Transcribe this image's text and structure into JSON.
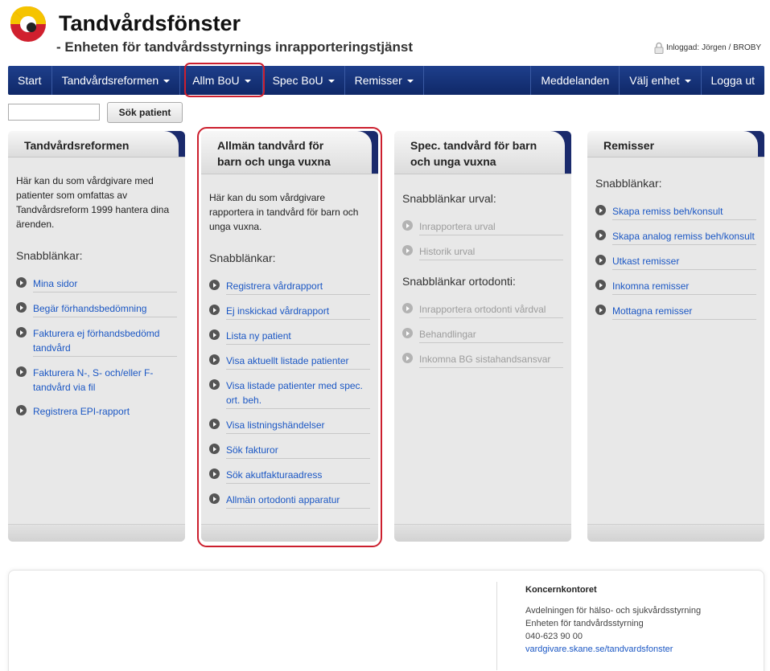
{
  "header": {
    "title": "Tandvårdsfönster",
    "subtitle": "- Enheten för tandvårdsstyrnings inrapporteringstjänst",
    "login_label": "Inloggad:",
    "login_user": "Jörgen / BROBY"
  },
  "nav": {
    "items": [
      {
        "label": "Start"
      },
      {
        "label": "Tandvårdsreformen"
      },
      {
        "label": "Allm BoU"
      },
      {
        "label": "Spec BoU"
      },
      {
        "label": "Remisser"
      }
    ],
    "right_items": [
      {
        "label": "Meddelanden"
      },
      {
        "label": "Välj enhet"
      },
      {
        "label": "Logga ut"
      }
    ]
  },
  "search": {
    "value": "",
    "button_label": "Sök patient"
  },
  "panels": [
    {
      "title": "Tandvårdsreformen",
      "intro": "Här kan du som vårdgivare med patienter som omfattas av Tandvårdsreform 1999 hantera dina ärenden.",
      "subhead": "Snabblänkar:",
      "links": [
        "Mina sidor",
        "Begär förhandsbedömning",
        "Fakturera ej förhandsbedömd tandvård",
        "Fakturera N-, S- och/eller F-tandvård via fil",
        "Registrera EPI-rapport"
      ]
    },
    {
      "title": "Allmän tandvård för barn och unga vuxna",
      "intro": "Här kan du som vårdgivare rapportera in tandvård för barn och unga vuxna.",
      "subhead": "Snabblänkar:",
      "links": [
        "Registrera vårdrapport",
        "Ej inskickad vårdrapport",
        "Lista ny patient",
        "Visa aktuellt listade patienter",
        "Visa listade patienter med spec. ort. beh.",
        "Visa listningshändelser",
        "Sök fakturor",
        "Sök akutfakturaadress",
        "Allmän ortodonti apparatur"
      ]
    },
    {
      "title": "Spec. tandvård för barn och unga vuxna",
      "subhead_urval": "Snabblänkar urval:",
      "links_urval": [
        "Inrapportera urval",
        "Historik urval"
      ],
      "subhead_ortodonti": "Snabblänkar ortodonti:",
      "links_ortodonti": [
        "Inrapportera ortodonti vårdval",
        "Behandlingar",
        "Inkomna BG sistahandsansvar"
      ]
    },
    {
      "title": "Remisser",
      "subhead": "Snabblänkar:",
      "links": [
        "Skapa remiss beh/konsult",
        "Skapa analog remiss beh/konsult",
        "Utkast remisser",
        "Inkomna remisser",
        "Mottagna remisser"
      ]
    }
  ],
  "footer": {
    "org": "Koncernkontoret",
    "line1": "Avdelningen för hälso- och sjukvårdsstyrning",
    "line2": "Enheten för tandvårdsstyrning",
    "phone": "040-623 90 00",
    "link": "vardgivare.skane.se/tandvardsfonster"
  },
  "colors": {
    "nav": "#1e3f8c",
    "link": "#1b57c4",
    "highlight": "#cc1f2e",
    "logo_yellow": "#f5c400",
    "logo_red": "#d0202e"
  }
}
